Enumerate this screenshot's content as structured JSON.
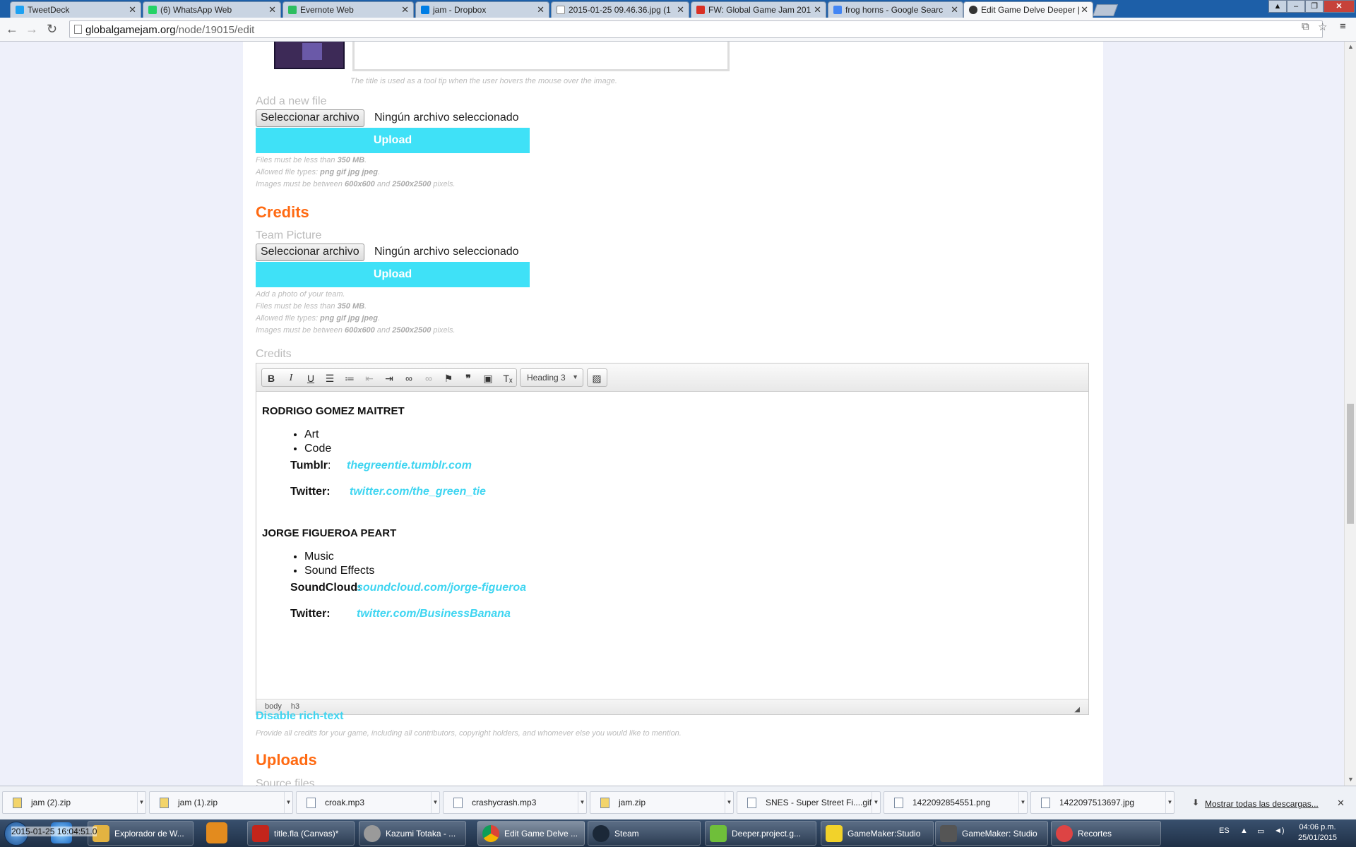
{
  "browser": {
    "tabs": [
      {
        "label": "TweetDeck",
        "color": "#1da1f2"
      },
      {
        "label": "(6) WhatsApp Web",
        "color": "#25d366"
      },
      {
        "label": "Evernote Web",
        "color": "#2dbe60"
      },
      {
        "label": "jam - Dropbox",
        "color": "#007ee5"
      },
      {
        "label": "2015-01-25 09.46.36.jpg (1",
        "color": "#dddddd"
      },
      {
        "label": "FW: Global Game Jam 201",
        "color": "#d93025"
      },
      {
        "label": "frog horns - Google Searc",
        "color": "#4285f4"
      },
      {
        "label": "Edit Game Delve Deeper | ",
        "color": "#333333"
      }
    ],
    "url_host": "globalgamejam.org",
    "url_path": "/node/19015/edit"
  },
  "form": {
    "image_title_hint": "The title is used as a tool tip when the user hovers the mouse over the image.",
    "add_file_label": "Add a new file",
    "choose_file_label": "Seleccionar archivo",
    "no_file_text": "Ningún archivo seleccionado",
    "upload_label": "Upload",
    "file_rules": {
      "size_prefix": "Files must be less than ",
      "size": "350 MB",
      "size_suffix": ".",
      "types_prefix": "Allowed file types: ",
      "types": "png gif jpg jpeg",
      "types_suffix": ".",
      "dims_prefix": "Images must be between ",
      "dims_min": "600x600",
      "dims_and": " and ",
      "dims_max": "2500x2500",
      "dims_suffix": " pixels."
    },
    "credits_heading": "Credits",
    "team_picture_label": "Team Picture",
    "team_picture_hint": "Add a photo of your team.",
    "credits_field_label": "Credits",
    "credits_hint": "Provide all credits for your game, including all contributors, copyright holders, and whomever else you would like to mention.",
    "disable_rich_text": "Disable rich-text",
    "uploads_heading": "Uploads",
    "source_files_label": "Source files"
  },
  "editor": {
    "format_select": "Heading 3",
    "toolbar_icons": [
      "bold-icon",
      "italic-icon",
      "underline-icon",
      "bulleted-list-icon",
      "numbered-list-icon",
      "outdent-icon",
      "indent-icon",
      "link-icon",
      "unlink-icon",
      "anchor-icon",
      "blockquote-icon",
      "paste-icon",
      "remove-format-icon",
      "image-icon"
    ],
    "people": [
      {
        "name": "RODRIGO GOMEZ MAITRET",
        "roles": [
          "Art",
          "Code"
        ],
        "links": [
          {
            "label": "Tumblr",
            "sep": ":",
            "value": "thegreentie.tumblr.com"
          },
          {
            "label": "Twitter:",
            "sep": "",
            "value": "twitter.com/the_green_tie"
          }
        ]
      },
      {
        "name": "JORGE FIGUEROA PEART",
        "roles": [
          "Music",
          "Sound Effects"
        ],
        "links": [
          {
            "label": "SoundCloud:",
            "sep": "",
            "value": "soundcloud.com/jorge-figueroa"
          },
          {
            "label": "Twitter:",
            "sep": "",
            "value": "twitter.com/BusinessBanana"
          }
        ]
      }
    ],
    "path": [
      "body",
      "h3"
    ]
  },
  "downloads": {
    "items": [
      "jam (2).zip",
      "jam (1).zip",
      "croak.mp3",
      "crashycrash.mp3",
      "jam.zip",
      "SNES - Super Street Fi....gif",
      "1422092854551.png",
      "1422097513697.jpg"
    ],
    "show_all": "Mostrar todas las descargas..."
  },
  "taskbar": {
    "overlay_time": "2015-01-25 16:04:51.0",
    "items": [
      {
        "label": "Explorador de W...",
        "color": "#e3b341"
      },
      {
        "label": "title.fla (Canvas)*",
        "color": "#c3251b"
      },
      {
        "label": "Kazumi Totaka - ...",
        "color": "#9a9a9a"
      },
      {
        "label": "Edit Game Delve ...",
        "color": "#e8e8e8"
      },
      {
        "label": "Steam",
        "color": "#1b2838"
      },
      {
        "label": "Deeper.project.g...",
        "color": "#6fbf3a"
      },
      {
        "label": "GameMaker:Studio",
        "color": "#f2d22a"
      },
      {
        "label": "GameMaker: Studio",
        "color": "#2a2a2a"
      },
      {
        "label": "Recortes",
        "color": "#d44"
      }
    ],
    "lang": "ES",
    "time": "04:06 p.m.",
    "date": "25/01/2015"
  }
}
